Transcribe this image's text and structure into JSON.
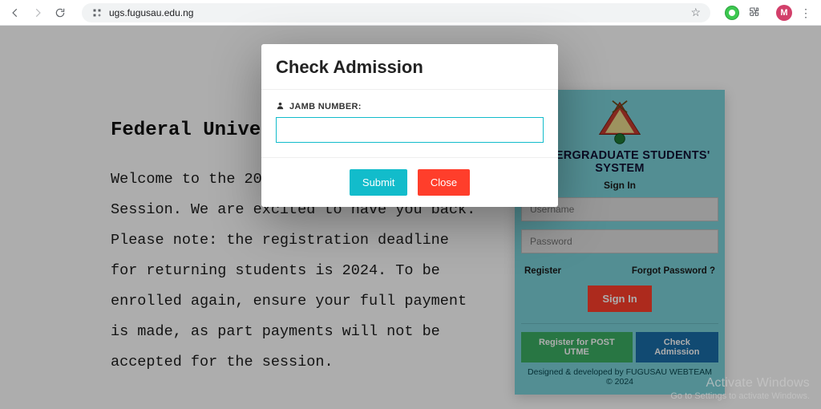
{
  "browser": {
    "url": "ugs.fugusau.edu.ng",
    "profile_initial": "M"
  },
  "welcome": {
    "heading": "Federal University Gusau",
    "body": "Welcome to the 2023/2024 Academic Session. We are excited to have you back. Please note: the registration deadline for returning students is 2024. To be enrolled again, ensure your full payment is made, as part payments will not be accepted for the session."
  },
  "card": {
    "title": "UNDERGRADUATE STUDENTS' SYSTEM",
    "signin_label": "Sign In",
    "username_placeholder": "Username",
    "password_placeholder": "Password",
    "register_link": "Register",
    "forgot_link": "Forgot Password ?",
    "signin_button": "Sign In",
    "reg_utme_button": "Register for POST UTME",
    "check_admission_button": "Check Admission",
    "footer_line1": "Designed & developed by FUGUSAU WEBTEAM",
    "footer_line2": "© 2024"
  },
  "modal": {
    "title": "Check Admission",
    "field_label": "JAMB NUMBER:",
    "input_value": "",
    "submit_label": "Submit",
    "close_label": "Close"
  },
  "watermark": {
    "line1": "Activate Windows",
    "line2": "Go to Settings to activate Windows."
  }
}
